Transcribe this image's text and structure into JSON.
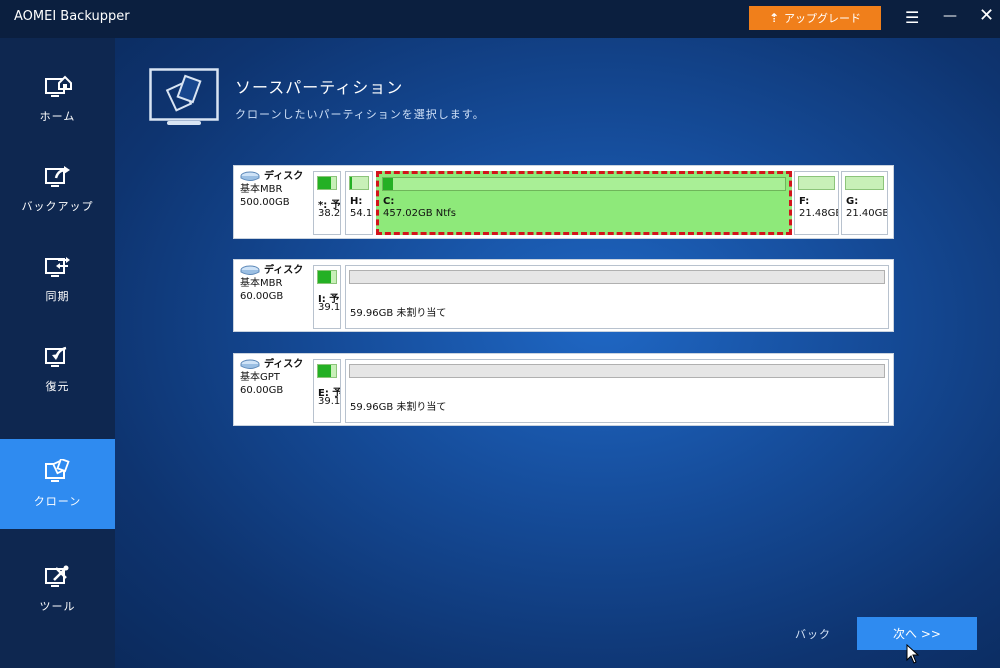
{
  "app": {
    "title": "AOMEI Backupper"
  },
  "titlebar": {
    "upgrade_label": "アップグレード"
  },
  "sidebar": {
    "items": [
      {
        "label": "ホーム",
        "icon": "home-icon"
      },
      {
        "label": "バックアップ",
        "icon": "backup-icon"
      },
      {
        "label": "同期",
        "icon": "sync-icon"
      },
      {
        "label": "復元",
        "icon": "restore-icon"
      },
      {
        "label": "クローン",
        "icon": "clone-icon",
        "active": true
      },
      {
        "label": "ツール",
        "icon": "tools-icon"
      }
    ]
  },
  "header": {
    "title": "ソースパーティション",
    "subtitle": "クローンしたいパーティションを選択します。"
  },
  "disks": [
    {
      "name": "ディスク",
      "type": "基本MBR",
      "size": "500.00GB",
      "partitions": [
        {
          "label": "*: 予",
          "size": "38.2"
        },
        {
          "label": "H:",
          "size": "54.1"
        },
        {
          "label": "C:",
          "size": "457.02GB Ntfs",
          "selected": true
        },
        {
          "label": "F:",
          "size": "21.48GB"
        },
        {
          "label": "G:",
          "size": "21.40GB"
        }
      ]
    },
    {
      "name": "ディスク",
      "type": "基本MBR",
      "size": "60.00GB",
      "partitions": [
        {
          "label": "I: 予",
          "size": "39.1"
        },
        {
          "label": "",
          "size": "59.96GB 未割り当て"
        }
      ]
    },
    {
      "name": "ディスク",
      "type": "基本GPT",
      "size": "60.00GB",
      "partitions": [
        {
          "label": "E: 予",
          "size": "39.1"
        },
        {
          "label": "",
          "size": "59.96GB 未割り当て"
        }
      ]
    }
  ],
  "footer": {
    "back_label": "バック",
    "next_label": "次へ >>"
  },
  "colors": {
    "accent": "#2f8bf0",
    "upgrade": "#f07f1b",
    "selected_partition": "#8ee97a",
    "selection_border": "#d3141b"
  }
}
